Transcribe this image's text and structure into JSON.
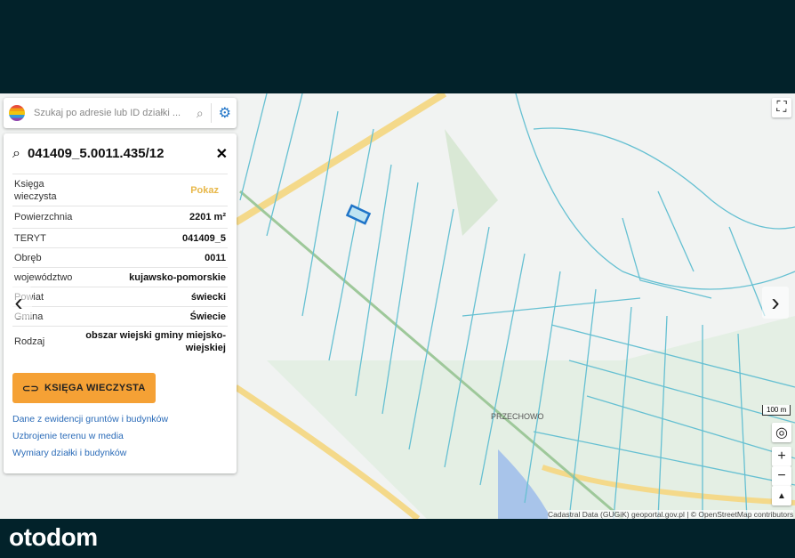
{
  "search": {
    "placeholder": "Szukaj po adresie lub ID działki ..."
  },
  "parcel": {
    "id": "041409_5.0011.435/12",
    "rows": [
      {
        "label": "Księga wieczysta",
        "value": "Pokaz"
      },
      {
        "label": "Powierzchnia",
        "value": "2201 m²"
      },
      {
        "label": "TERYT",
        "value": "041409_5"
      },
      {
        "label": "Obręb",
        "value": "0011"
      },
      {
        "label": "województwo",
        "value": "kujawsko-pomorskie"
      },
      {
        "label": "Powiat",
        "value": "świecki"
      },
      {
        "label": "Gmina",
        "value": "Świecie"
      },
      {
        "label": "Rodzaj",
        "value": "obszar wiejski gminy miejsko-wiejskiej"
      }
    ],
    "button": "KSIĘGA WIECZYSTA",
    "links": [
      "Dane z ewidencji gruntów i budynków",
      "Uzbrojenie terenu w media",
      "Wymiary działki i budynków"
    ]
  },
  "map": {
    "place_label": "PRZECHOWO",
    "scale": "100 m",
    "attribution": "Cadastral Data (GUGiK) geoportal.gov.pl | © OpenStreetMap contributors"
  },
  "footer": {
    "brand": "otodom"
  }
}
